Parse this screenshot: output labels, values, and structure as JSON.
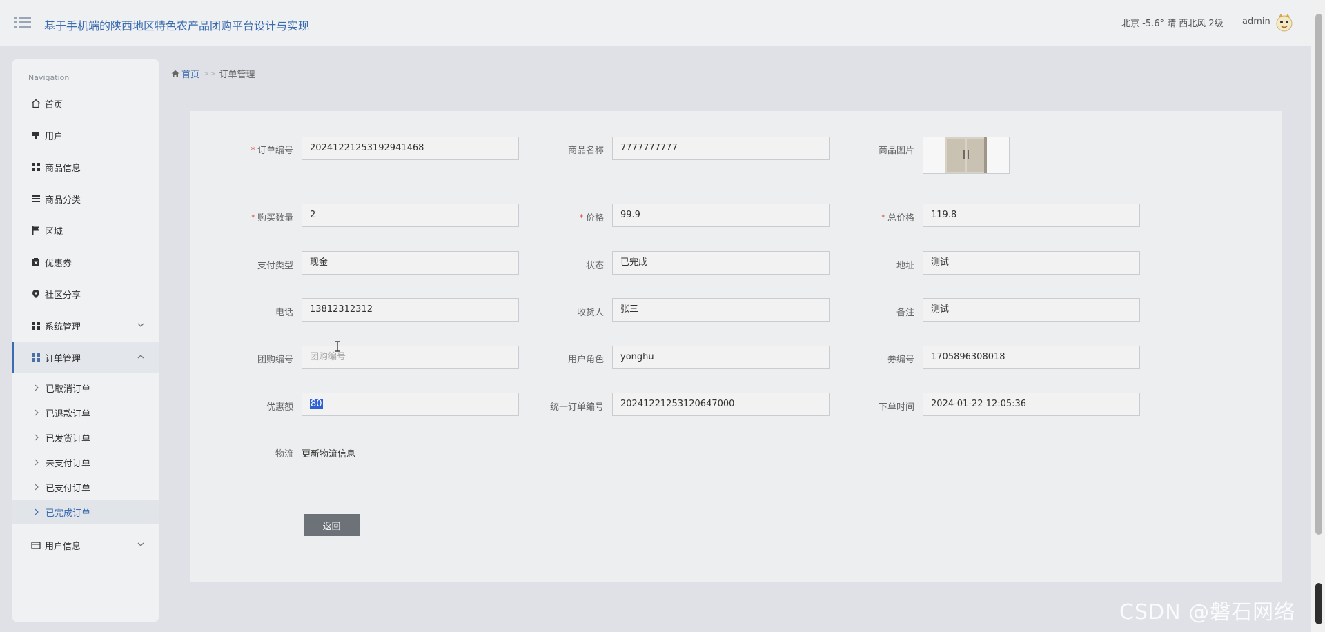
{
  "header": {
    "title": "基于手机端的陕西地区特色农产品团购平台设计与实现",
    "weather": "北京  -5.6°  晴  西北风  2级",
    "username": "admin"
  },
  "sidebar": {
    "heading": "Navigation",
    "items": [
      {
        "label": "首页",
        "icon": "home-icon"
      },
      {
        "label": "用户",
        "icon": "user-icon"
      },
      {
        "label": "商品信息",
        "icon": "grid-icon"
      },
      {
        "label": "商品分类",
        "icon": "list-icon"
      },
      {
        "label": "区域",
        "icon": "flag-icon"
      },
      {
        "label": "优惠券",
        "icon": "coupon-icon"
      },
      {
        "label": "社区分享",
        "icon": "location-icon"
      },
      {
        "label": "系统管理",
        "icon": "grid-icon"
      },
      {
        "label": "订单管理",
        "icon": "grid-icon"
      },
      {
        "label": "用户信息",
        "icon": "card-icon"
      }
    ],
    "order_sub": [
      {
        "label": "已取消订单"
      },
      {
        "label": "已退款订单"
      },
      {
        "label": "已发货订单"
      },
      {
        "label": "未支付订单"
      },
      {
        "label": "已支付订单"
      },
      {
        "label": "已完成订单"
      }
    ]
  },
  "breadcrumb": {
    "home": "首页",
    "separator": ">>",
    "current": "订单管理"
  },
  "form": {
    "order_no": {
      "label": "订单编号",
      "value": "20241221253192941468"
    },
    "product_name": {
      "label": "商品名称",
      "value": "7777777777"
    },
    "product_image": {
      "label": "商品图片"
    },
    "quantity": {
      "label": "购买数量",
      "value": "2"
    },
    "price": {
      "label": "价格",
      "value": "99.9"
    },
    "total": {
      "label": "总价格",
      "value": "119.8"
    },
    "pay_type": {
      "label": "支付类型",
      "value": "现金"
    },
    "status": {
      "label": "状态",
      "value": "已完成"
    },
    "address": {
      "label": "地址",
      "value": "测试"
    },
    "phone": {
      "label": "电话",
      "value": "13812312312"
    },
    "receiver": {
      "label": "收货人",
      "value": "张三"
    },
    "remark": {
      "label": "备注",
      "value": "测试"
    },
    "group_no": {
      "label": "团购编号",
      "placeholder": "团购编号"
    },
    "user_role": {
      "label": "用户角色",
      "value": "yonghu"
    },
    "coupon_no": {
      "label": "券编号",
      "value": "1705896308018"
    },
    "discount": {
      "label": "优惠额",
      "value": "80"
    },
    "unified_order_no": {
      "label": "统一订单编号",
      "value": "20241221253120647000"
    },
    "order_time": {
      "label": "下单时间",
      "value": "2024-01-22 12:05:36"
    },
    "logistics": {
      "label": "物流",
      "link": "更新物流信息"
    },
    "back_button": "返回"
  },
  "watermark": "CSDN @磐石网络",
  "colors": {
    "accent": "#3b6bb0",
    "required": "#e05252",
    "button": "#6d7278"
  }
}
